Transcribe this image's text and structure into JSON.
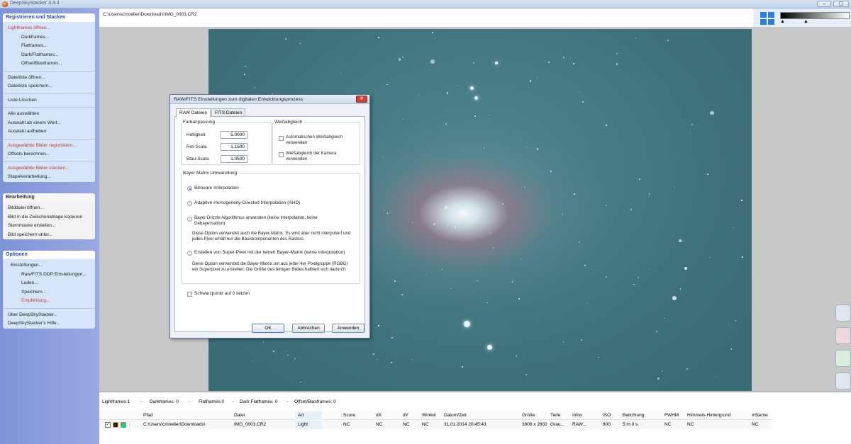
{
  "window": {
    "title": "DeepSkyStacker 3.3.4",
    "minimize": "–",
    "maximize": "▢",
    "close": "✕"
  },
  "sidebar": {
    "register": {
      "header": "Registrieren und Stacken",
      "items": [
        {
          "label": "Lightframes öffnen...",
          "red": true,
          "level": 1
        },
        {
          "label": "Darkframes...",
          "red": false,
          "level": 3
        },
        {
          "label": "Flatframes...",
          "red": false,
          "level": 3
        },
        {
          "label": "Dark/Flatframes...",
          "red": false,
          "level": 3
        },
        {
          "label": "Offset/Biasframes...",
          "red": false,
          "level": 3
        },
        {
          "label": "Dateiliste öffnen...",
          "red": false,
          "level": 1
        },
        {
          "label": "Dateiliste speichern...",
          "red": false,
          "level": 1
        },
        {
          "label": "Liste Löschen",
          "red": false,
          "level": 1
        },
        {
          "label": "Alle auswählen",
          "red": false,
          "level": 1
        },
        {
          "label": "Auswahl ab einem Wert...",
          "red": false,
          "level": 1
        },
        {
          "label": "Auswahl aufheben",
          "red": false,
          "level": 1
        },
        {
          "label": "Ausgewählte Bilder registrieren...",
          "red": true,
          "level": 1
        },
        {
          "label": "Offsets berechnen...",
          "red": false,
          "level": 1
        },
        {
          "label": "Ausgewählte Bilder stacken...",
          "red": true,
          "level": 1
        },
        {
          "label": "Stapelverarbeitung...",
          "red": false,
          "level": 1
        }
      ]
    },
    "edit": {
      "header": "Bearbeitung",
      "items": [
        {
          "label": "Bilddatei öffnen...",
          "red": false,
          "level": 1
        },
        {
          "label": "Bild in die Zwischenablage kopieren",
          "red": false,
          "level": 1
        },
        {
          "label": "Sternmaske erstellen...",
          "red": false,
          "level": 1
        },
        {
          "label": "Bild speichern unter...",
          "red": false,
          "level": 1
        }
      ]
    },
    "options": {
      "header": "Optionen",
      "items": [
        {
          "label": "Einstellungen...",
          "red": false,
          "level": 2
        },
        {
          "label": "Raw/FITS DDP Einstellungen...",
          "red": false,
          "level": 3
        },
        {
          "label": "Laden...",
          "red": false,
          "level": 3
        },
        {
          "label": "Speichern...",
          "red": false,
          "level": 3
        },
        {
          "label": "Empfehlung...",
          "red": true,
          "level": 3
        },
        {
          "label": "Über DeepSkyStacker...",
          "red": false,
          "level": 1
        },
        {
          "label": "DeepSkyStacker's Hilfe...",
          "red": false,
          "level": 1
        }
      ]
    }
  },
  "path": "C:\\Users\\cmoeller\\Downloads\\IMG_0003.CR2",
  "slider_handle": "▲",
  "dialog": {
    "title": "RAW/FITS Einstellungen zum digitalen Entwicklungsprozess",
    "close": "✕",
    "tabs": [
      "RAW Dateien",
      "FITS Dateien"
    ],
    "color_adjust": {
      "legend": "Farbanpassung",
      "brightness_label": "Helligkeit",
      "brightness": "5.0000",
      "red_label": "Rot-Scala",
      "red": "1.1500",
      "blue_label": "Blau-Scala",
      "blue": "1.0500"
    },
    "white_balance": {
      "legend": "Weißabgleich",
      "auto": "Automatischen Weißabgleich verwenden",
      "camera": "Weißabgleich der Kamera verwenden"
    },
    "bayer": {
      "legend": "Bayer Matrix Umwandlung",
      "bilinear": "Bilineare Interpolation",
      "ahd": "Adaptive Homogeneity-Directed Interpolation (AHD)",
      "drizzle": "Bayer Drizzle Algorithmus anwenden (keine Interpolation, keine Debayerisation)",
      "drizzle_desc": "Diese Option verwendet auch die Bayer-Matrix. Es wird aber nicht interpoliert und jedes Pixel erhält nur die Basiskomponenten des Rasters.",
      "superpixel": "Erstellen von Super-Pixel mit der reinen Bayer-Matrix (keine Interpolation)",
      "superpixel_desc": "Diese Option verwendet die Bayer-Matrix um aus jeder 4er Pixelgruppe (RGBG) ein Superpixel zu erstellen. Die Größe des fertigen Bildes halbiert sich dadurch."
    },
    "black_point": "Schwarzpunkt auf 0 setzen",
    "buttons": {
      "ok": "OK",
      "cancel": "Abbrechen",
      "apply": "Anwenden"
    }
  },
  "stats": {
    "lightframes": "Lightframes:1",
    "darkframes": "Darkframes: 0",
    "flatframes": "Flatframes:0",
    "darkflat": "Dark Flatframes: 0",
    "offset": "Offset/Biasframes: 0"
  },
  "table": {
    "columns": [
      "Pfad",
      "Datei",
      "Art",
      "Score",
      "dX",
      "dY",
      "Winkel",
      "Datum/Zeit",
      "Größe",
      "Tiefe",
      "Infos",
      "ISO",
      "Belichtung",
      "FWHM",
      "Himmels-Hintergrund",
      "#Sterne"
    ],
    "row": {
      "checked": "✓",
      "cells": [
        "C:\\Users\\cmoeller\\Downloads\\",
        "IMG_0003.CR2",
        "Light",
        "NC",
        "NC",
        "NC",
        "NC",
        "31.01.2014 20:45:43",
        "3906 x 2602",
        "Grau...",
        "RAW...",
        "800",
        "5 m 0 s",
        "NC",
        "NC",
        "NC"
      ]
    }
  }
}
